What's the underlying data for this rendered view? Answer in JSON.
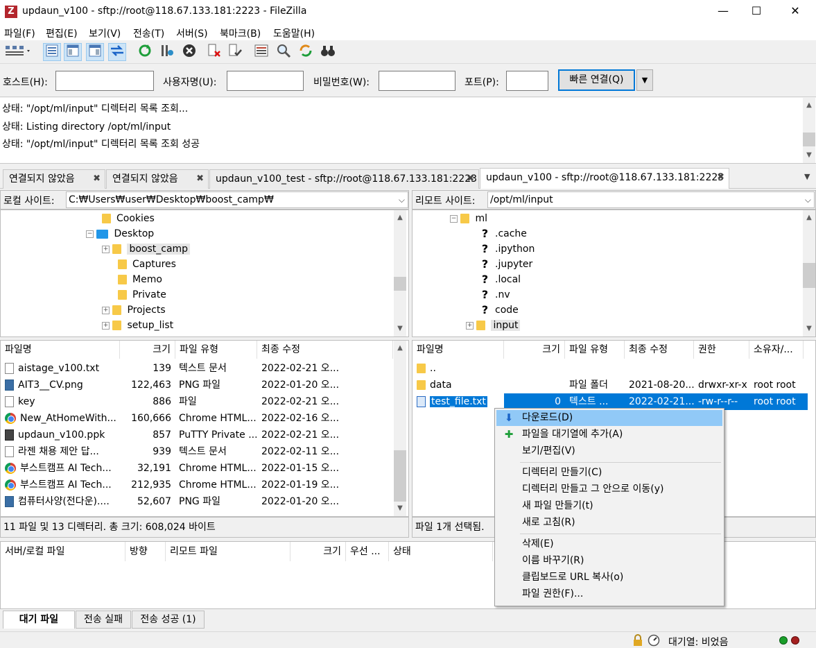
{
  "window": {
    "title": "updaun_v100 - sftp://root@118.67.133.181:2223 - FileZilla",
    "app_icon": "Z",
    "controls": [
      "—",
      "☐",
      "✕"
    ]
  },
  "menu": [
    "파일(F)",
    "편집(E)",
    "보기(V)",
    "전송(T)",
    "서버(S)",
    "북마크(B)",
    "도움말(H)"
  ],
  "toolbar_icons": [
    "site-manager-icon",
    "toggle-log-icon",
    "toggle-local-tree-icon",
    "toggle-remote-tree-icon",
    "toggle-queue-icon",
    "refresh-icon",
    "process-queue-icon",
    "cancel-icon",
    "disconnect-icon",
    "reconnect-icon",
    "directory-filter-icon",
    "search-icon",
    "sync-browse-icon",
    "binoculars-icon"
  ],
  "quickconnect": {
    "host_label": "호스트(H):",
    "user_label": "사용자명(U):",
    "pass_label": "비밀번호(W):",
    "port_label": "포트(P):",
    "host_value": "",
    "user_value": "",
    "pass_value": "",
    "port_value": "",
    "connect_label": "빠른 연결(Q)",
    "dropdown": "▼"
  },
  "log": [
    "상태:  \"/opt/ml/input\" 디렉터리 목록 조회...",
    "상태:  Listing directory /opt/ml/input",
    "상태:  \"/opt/ml/input\" 디렉터리 목록 조회 성공"
  ],
  "tabs": [
    {
      "label": "연결되지 않았음",
      "active": false
    },
    {
      "label": "연결되지 않았음",
      "active": false
    },
    {
      "label": "updaun_v100_test - sftp://root@118.67.133.181:2223",
      "active": false
    },
    {
      "label": "updaun_v100 - sftp://root@118.67.133.181:2223",
      "active": true
    }
  ],
  "local": {
    "site_label": "로컬 사이트:",
    "site_path": "C:₩Users₩user₩Desktop₩boost_camp₩",
    "tree": [
      {
        "label": "Cookies",
        "indent": 0,
        "expander": "",
        "kind": "folder"
      },
      {
        "label": "Desktop",
        "indent": 0,
        "expander": "−",
        "kind": "blue"
      },
      {
        "label": "boost_camp",
        "indent": 1,
        "expander": "+",
        "kind": "folder",
        "selected": true
      },
      {
        "label": "Captures",
        "indent": 1,
        "expander": "",
        "kind": "folder"
      },
      {
        "label": "Memo",
        "indent": 1,
        "expander": "",
        "kind": "folder"
      },
      {
        "label": "Private",
        "indent": 1,
        "expander": "",
        "kind": "folder"
      },
      {
        "label": "Projects",
        "indent": 1,
        "expander": "+",
        "kind": "folder"
      },
      {
        "label": "setup_list",
        "indent": 1,
        "expander": "+",
        "kind": "folder"
      }
    ],
    "columns": [
      "파일명",
      "크기",
      "파일 유형",
      "최종 수정"
    ],
    "files": [
      {
        "name": "aistage_v100.txt",
        "size": "139",
        "type": "텍스트 문서",
        "modified": "2022-02-21 오...",
        "icon": "txt"
      },
      {
        "name": "AIT3__CV.png",
        "size": "122,463",
        "type": "PNG 파일",
        "modified": "2022-01-20 오...",
        "icon": "png"
      },
      {
        "name": "key",
        "size": "886",
        "type": "파일",
        "modified": "2022-02-21 오...",
        "icon": "blank"
      },
      {
        "name": "New_AtHomeWith...",
        "size": "160,666",
        "type": "Chrome HTML...",
        "modified": "2022-02-16 오...",
        "icon": "chrome"
      },
      {
        "name": "updaun_v100.ppk",
        "size": "857",
        "type": "PuTTY Private ...",
        "modified": "2022-02-21 오...",
        "icon": "ppk"
      },
      {
        "name": "라젠 채용 제안 답...",
        "size": "939",
        "type": "텍스트 문서",
        "modified": "2022-02-11 오...",
        "icon": "txt"
      },
      {
        "name": "부스트캠프 AI Tech...",
        "size": "32,191",
        "type": "Chrome HTML...",
        "modified": "2022-01-15 오...",
        "icon": "chrome"
      },
      {
        "name": "부스트캠프 AI Tech...",
        "size": "212,935",
        "type": "Chrome HTML...",
        "modified": "2022-01-19 오...",
        "icon": "chrome"
      },
      {
        "name": "컴퓨터사양(전다운)....",
        "size": "52,607",
        "type": "PNG 파일",
        "modified": "2022-01-20 오...",
        "icon": "png"
      }
    ],
    "status": "11 파일 및 13 디렉터리. 총 크기: 608,024 바이트"
  },
  "remote": {
    "site_label": "리모트 사이트:",
    "site_path": "/opt/ml/input",
    "tree": [
      {
        "label": "ml",
        "indent": 0,
        "expander": "−",
        "kind": "folder"
      },
      {
        "label": ".cache",
        "indent": 1,
        "expander": "",
        "kind": "q"
      },
      {
        "label": ".ipython",
        "indent": 1,
        "expander": "",
        "kind": "q"
      },
      {
        "label": ".jupyter",
        "indent": 1,
        "expander": "",
        "kind": "q"
      },
      {
        "label": ".local",
        "indent": 1,
        "expander": "",
        "kind": "q"
      },
      {
        "label": ".nv",
        "indent": 1,
        "expander": "",
        "kind": "q"
      },
      {
        "label": "code",
        "indent": 1,
        "expander": "",
        "kind": "q"
      },
      {
        "label": "input",
        "indent": 1,
        "expander": "+",
        "kind": "folder",
        "selected": true
      }
    ],
    "columns": [
      "파일명",
      "크기",
      "파일 유형",
      "최종 수정",
      "권한",
      "소유자/..."
    ],
    "files": [
      {
        "name": "..",
        "size": "",
        "type": "",
        "modified": "",
        "perm": "",
        "owner": "",
        "icon": "folder"
      },
      {
        "name": "data",
        "size": "",
        "type": "파일 폴더",
        "modified": "2021-08-20...",
        "perm": "drwxr-xr-x",
        "owner": "root root",
        "icon": "folder"
      },
      {
        "name": "test_file.txt",
        "size": "0",
        "type": "텍스트 ...",
        "modified": "2022-02-21...",
        "perm": "-rw-r--r--",
        "owner": "root root",
        "icon": "txtblue",
        "selected": true
      }
    ],
    "status": "파일 1개 선택됨."
  },
  "queue": {
    "columns": [
      "서버/로컬 파일",
      "방향",
      "리모트 파일",
      "크기",
      "우선 ...",
      "상태"
    ],
    "tabs": [
      "대기 파일",
      "전송 실패",
      "전송 성공 (1)"
    ]
  },
  "statusbar": {
    "queue_text": "대기열: 비었음"
  },
  "context_menu": {
    "items": [
      {
        "label": "다운로드(D)",
        "icon": "download-arrow-icon",
        "glyph": "⬇",
        "highlighted": true
      },
      {
        "label": "파일을 대기열에 추가(A)",
        "icon": "add-queue-icon",
        "glyph": "✚"
      },
      {
        "label": "보기/편집(V)"
      },
      {
        "sep": true
      },
      {
        "label": "디렉터리 만들기(C)"
      },
      {
        "label": "디렉터리 만들고 그 안으로 이동(y)"
      },
      {
        "label": "새 파일 만들기(t)"
      },
      {
        "label": "새로 고침(R)"
      },
      {
        "sep": true
      },
      {
        "label": "삭제(E)"
      },
      {
        "label": "이름 바꾸기(R)"
      },
      {
        "label": "클립보드로 URL 복사(o)"
      },
      {
        "label": "파일 권한(F)..."
      }
    ]
  }
}
